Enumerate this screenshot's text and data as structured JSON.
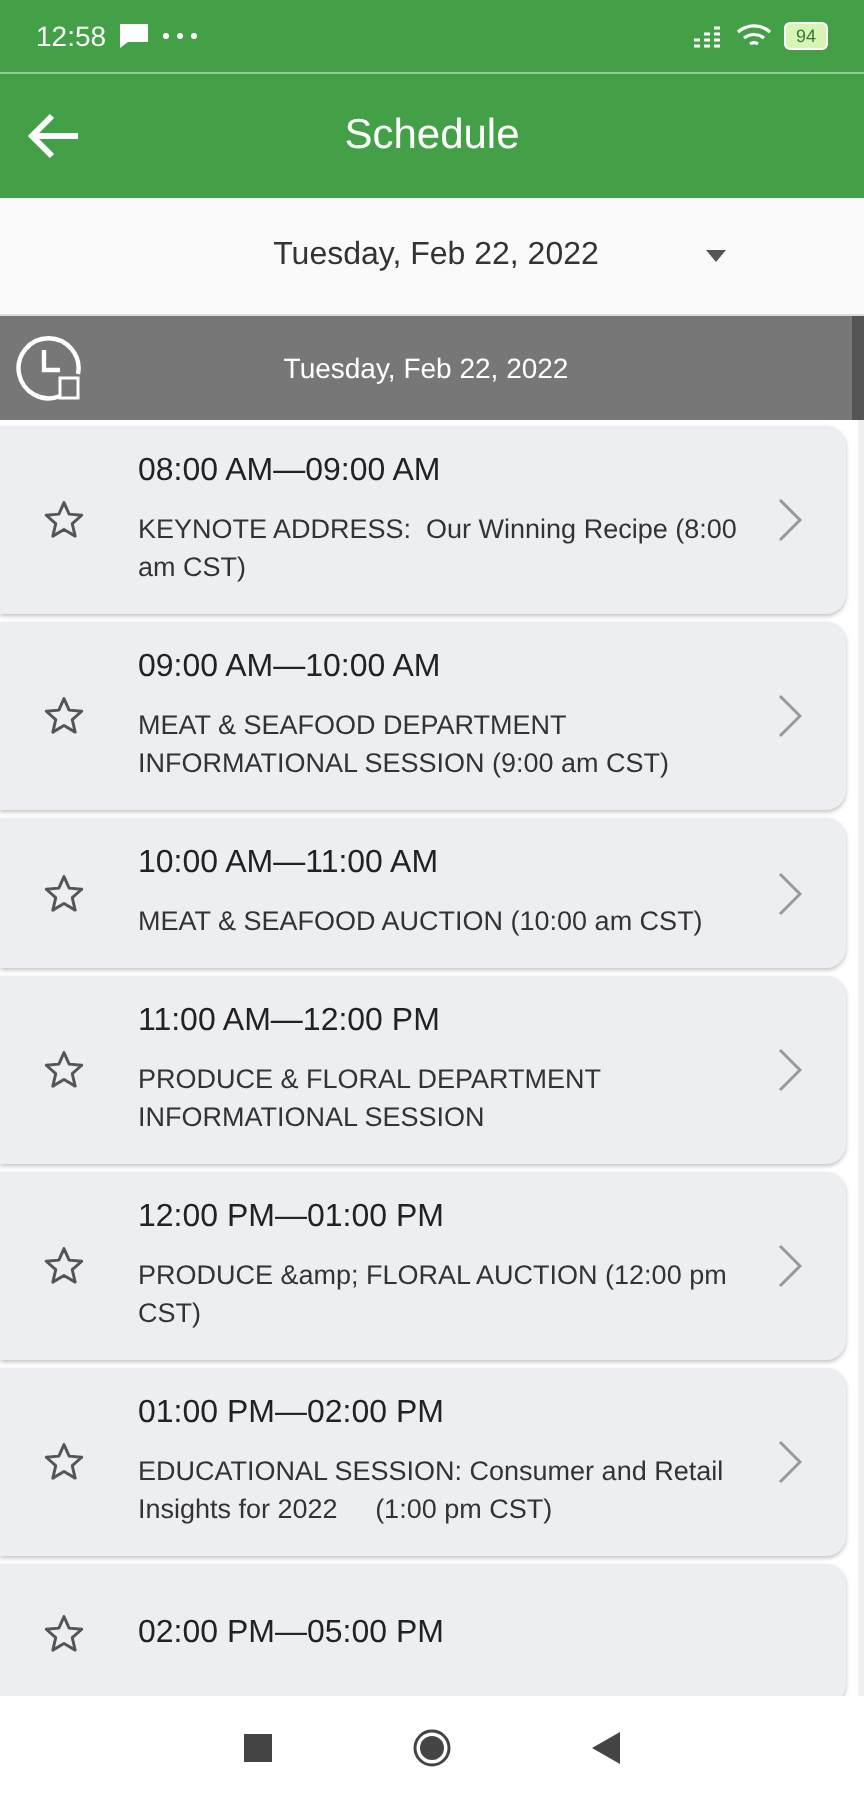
{
  "status_bar": {
    "time": "12:58",
    "battery": "94"
  },
  "app_bar": {
    "title": "Schedule"
  },
  "date_picker": {
    "value": "Tuesday, Feb 22, 2022"
  },
  "day_header": {
    "label": "Tuesday, Feb 22, 2022"
  },
  "sessions": [
    {
      "time": "08:00 AM—09:00 AM",
      "title": "KEYNOTE ADDRESS:  Our Winning Recipe (8:00 am CST)",
      "starred": false
    },
    {
      "time": "09:00 AM—10:00 AM",
      "title": "MEAT & SEAFOOD DEPARTMENT INFORMATIONAL SESSION (9:00 am CST)",
      "starred": false
    },
    {
      "time": "10:00 AM—11:00 AM",
      "title": "MEAT & SEAFOOD AUCTION (10:00 am CST)",
      "starred": false
    },
    {
      "time": "11:00 AM—12:00 PM",
      "title": "PRODUCE & FLORAL DEPARTMENT INFORMATIONAL SESSION",
      "starred": false
    },
    {
      "time": "12:00 PM—01:00 PM",
      "title": "PRODUCE &amp; FLORAL AUCTION (12:00 pm CST)",
      "starred": false
    },
    {
      "time": "01:00 PM—02:00 PM",
      "title": "EDUCATIONAL SESSION: Consumer and Retail Insights for 2022     (1:00 pm CST)",
      "starred": false
    },
    {
      "time": "02:00 PM—05:00 PM",
      "starred": false
    }
  ]
}
